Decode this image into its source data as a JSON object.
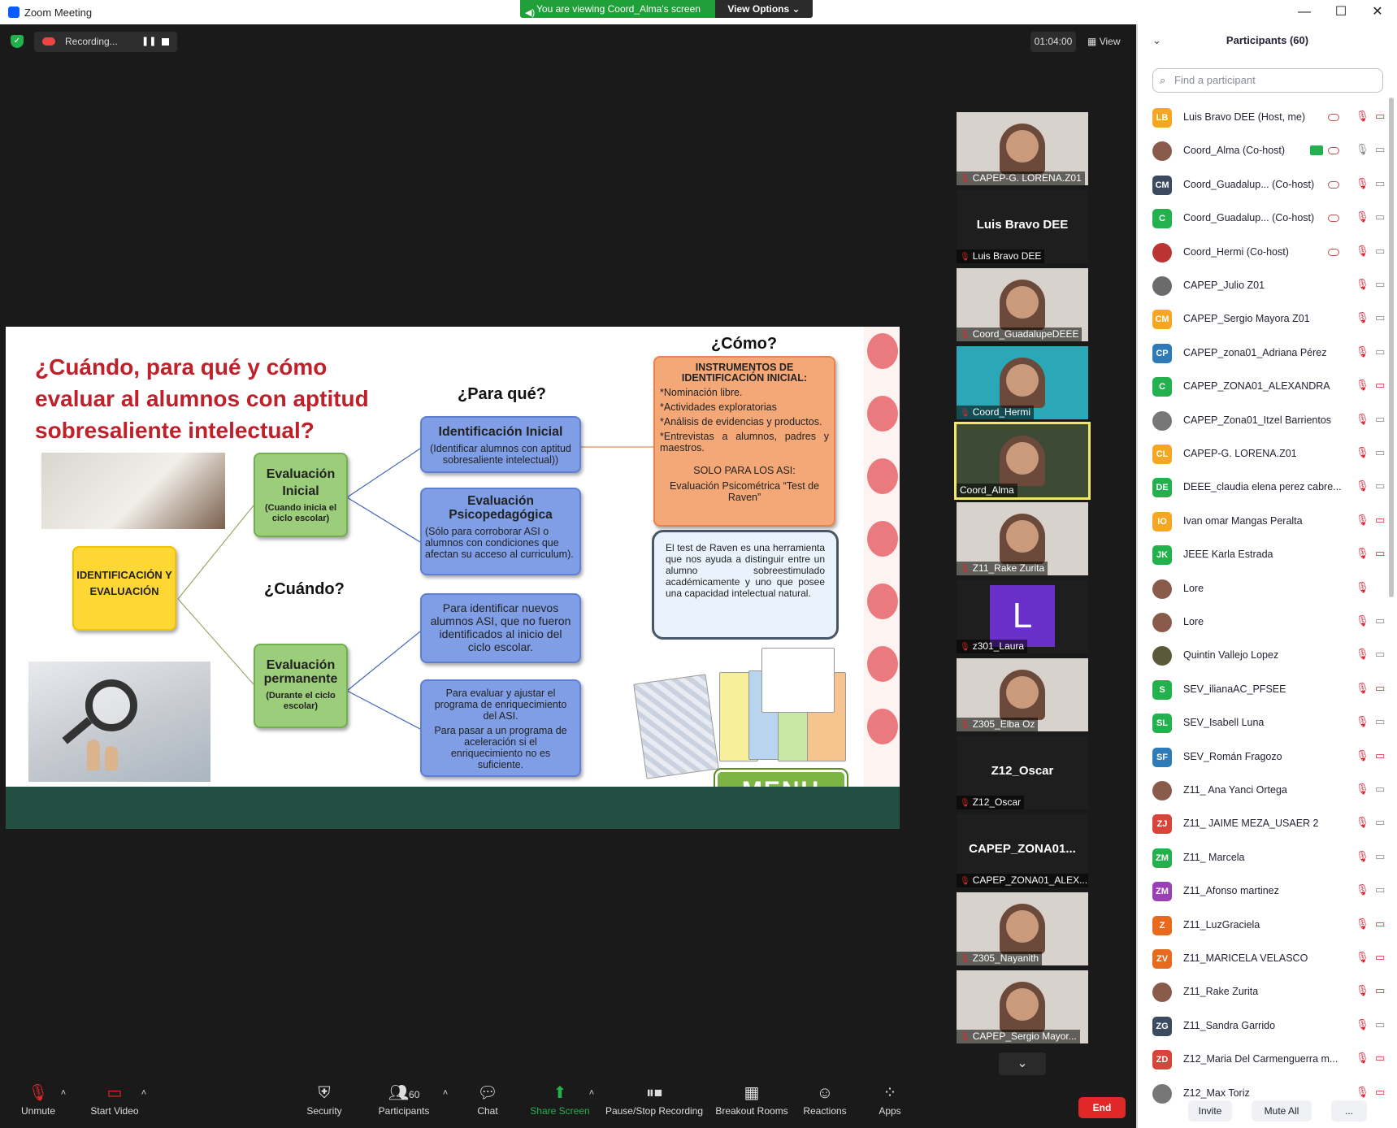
{
  "window": {
    "title": "Zoom Meeting",
    "banner": "You are viewing Coord_Alma's screen",
    "view_options": "View Options"
  },
  "topbar": {
    "recording": "Recording...",
    "timer": "01:04:00",
    "view": "View"
  },
  "slide": {
    "heading": "¿Cuándo, para qué y cómo evaluar al alumnos con aptitud sobresaliente intelectual?",
    "q_paraque": "¿Para qué?",
    "q_cuando": "¿Cuándo?",
    "q_como": "¿Cómo?",
    "ident": "IDENTIFICACIÓN Y EVALUACIÓN",
    "eval_inicial_title": "Evaluación Inicial",
    "eval_inicial_sub": "(Cuando inicia el ciclo escolar)",
    "eval_perm_title": "Evaluación permanente",
    "eval_perm_sub": "(Durante el ciclo escolar)",
    "ident_inicial_title": "Identificación Inicial",
    "ident_inicial_sub": "(Identificar alumnos con aptitud sobresaliente intelectual))",
    "psico_title": "Evaluación Psicopedagógica",
    "psico_sub": "(Sólo para corroborar ASI o alumnos con condiciones que afectan su acceso al curriculum).",
    "nuevos": "Para identificar nuevos alumnos ASI, que no fueron identificados al inicio del ciclo escolar.",
    "ajustar1": "Para evaluar y ajustar el programa de enriquecimiento del ASI.",
    "ajustar2": "Para pasar a un programa de aceleración si el enriquecimiento no es suficiente.",
    "instr_title": "INSTRUMENTOS DE IDENTIFICACIÓN INICIAL:",
    "instr_1": "*Nominación libre.",
    "instr_2": "*Actividades exploratorias",
    "instr_3": "*Análisis de evidencias y productos.",
    "instr_4": "*Entrevistas a alumnos, padres y maestros.",
    "solo": "SOLO PARA LOS ASI:",
    "raven_eval": "Evaluación Psicométrica “Test de Raven”",
    "raven_text": "El test de Raven es una herramienta que nos ayuda a distinguir entre un alumno sobreestimulado académicamente y uno que posee una capacidad intelectual natural.",
    "menu": "MENU"
  },
  "gallery": [
    {
      "name": "CAPEP-G. LORENA.Z01",
      "muted": true,
      "type": "video"
    },
    {
      "name": "Luis Bravo DEE",
      "muted": true,
      "type": "name",
      "big": "Luis Bravo DEE"
    },
    {
      "name": "Coord_GuadalupeDEEE",
      "muted": true,
      "type": "video"
    },
    {
      "name": "Coord_Hermi",
      "muted": true,
      "type": "video"
    },
    {
      "name": "Coord_Alma",
      "muted": false,
      "type": "video",
      "selected": true
    },
    {
      "name": "Z11_Rake Zurita",
      "muted": true,
      "type": "video"
    },
    {
      "name": "z301_Laura",
      "muted": true,
      "type": "letter",
      "big": "L"
    },
    {
      "name": "Z305_Elba Oz",
      "muted": true,
      "type": "video"
    },
    {
      "name": "Z12_Oscar",
      "muted": true,
      "type": "name",
      "big": "Z12_Oscar"
    },
    {
      "name": "CAPEP_ZONA01_ALEX...",
      "muted": true,
      "type": "name",
      "big": "CAPEP_ZONA01..."
    },
    {
      "name": "Z305_Nayanith",
      "muted": true,
      "type": "video"
    },
    {
      "name": "CAPEP_Sergio Mayor...",
      "muted": true,
      "type": "video"
    }
  ],
  "toolbar": {
    "unmute": "Unmute",
    "start_video": "Start Video",
    "security": "Security",
    "participants": "Participants",
    "participants_count": "60",
    "chat": "Chat",
    "share": "Share Screen",
    "pause_rec": "Pause/Stop Recording",
    "breakout": "Breakout Rooms",
    "reactions": "Reactions",
    "apps": "Apps",
    "end": "End"
  },
  "panel": {
    "title": "Participants (60)",
    "search_placeholder": "Find a participant",
    "invite": "Invite",
    "mute_all": "Mute All",
    "more": "...",
    "participants": [
      {
        "initials": "LB",
        "color": "#f5a623",
        "name": "Luis Bravo DEE (Host, me)",
        "rec": true,
        "cam_off": true
      },
      {
        "initials": "",
        "color": "#8a5a4a",
        "name": "Coord_Alma (Co-host)",
        "rec": true,
        "sharing": true,
        "mic_on": true
      },
      {
        "initials": "CM",
        "color": "#3b4a5e",
        "name": "Coord_Guadalup... (Co-host)",
        "rec": true
      },
      {
        "initials": "C",
        "color": "#23b14d",
        "name": "Coord_Guadalup... (Co-host)",
        "rec": true
      },
      {
        "initials": "",
        "color": "#b33",
        "name": "Coord_Hermi (Co-host)",
        "rec": true
      },
      {
        "initials": "",
        "color": "#6b6b6b",
        "name": "CAPEP_Julio Z01"
      },
      {
        "initials": "CM",
        "color": "#f5a623",
        "name": "CAPEP_Sergio Mayora Z01"
      },
      {
        "initials": "CP",
        "color": "#2d7bb8",
        "name": "CAPEP_zona01_Adriana Pérez"
      },
      {
        "initials": "C",
        "color": "#23b14d",
        "name": "CAPEP_ZONA01_ALEXANDRA",
        "cam_off": true
      },
      {
        "initials": "",
        "color": "#777",
        "name": "CAPEP_Zona01_Itzel Barrientos"
      },
      {
        "initials": "CL",
        "color": "#f5a623",
        "name": "CAPEP-G. LORENA.Z01"
      },
      {
        "initials": "DE",
        "color": "#23b14d",
        "name": "DEEE_claudia elena perez cabre..."
      },
      {
        "initials": "IO",
        "color": "#f5a623",
        "name": "Ivan omar Mangas Peralta",
        "cam_off": true
      },
      {
        "initials": "JK",
        "color": "#23b14d",
        "name": "JEEE Karla Estrada",
        "cam_off": true
      },
      {
        "initials": "",
        "color": "#8a5a4a",
        "name": "Lore",
        "no_cam": true
      },
      {
        "initials": "",
        "color": "#8a5a4a",
        "name": "Lore"
      },
      {
        "initials": "",
        "color": "#5a5a3a",
        "name": "Quintin Vallejo Lopez"
      },
      {
        "initials": "S",
        "color": "#23b14d",
        "name": "SEV_ilianaAC_PFSEE",
        "cam_off": true
      },
      {
        "initials": "SL",
        "color": "#23b14d",
        "name": "SEV_Isabell Luna"
      },
      {
        "initials": "SF",
        "color": "#2d7bb8",
        "name": "SEV_Román Fragozo",
        "cam_off": true
      },
      {
        "initials": "",
        "color": "#8a5a4a",
        "name": "Z11_ Ana Yanci Ortega"
      },
      {
        "initials": "ZJ",
        "color": "#d9443a",
        "name": "Z11_ JAIME MEZA_USAER 2"
      },
      {
        "initials": "ZM",
        "color": "#23b14d",
        "name": "Z11_ Marcela"
      },
      {
        "initials": "ZM",
        "color": "#9b3fb5",
        "name": "Z11_Afonso martinez"
      },
      {
        "initials": "Z",
        "color": "#e86a1e",
        "name": "Z11_LuzGraciela",
        "cam_off": true
      },
      {
        "initials": "ZV",
        "color": "#e86a1e",
        "name": "Z11_MARICELA VELASCO",
        "cam_off": true
      },
      {
        "initials": "",
        "color": "#8a5a4a",
        "name": "Z11_Rake Zurita",
        "cam_off": true
      },
      {
        "initials": "ZG",
        "color": "#3b4a5e",
        "name": "Z11_Sandra Garrido"
      },
      {
        "initials": "ZD",
        "color": "#d9443a",
        "name": "Z12_Maria Del Carmenguerra m...",
        "cam_off": true
      },
      {
        "initials": "",
        "color": "#777",
        "name": "Z12_Max Toriz",
        "cam_off": true
      }
    ]
  }
}
